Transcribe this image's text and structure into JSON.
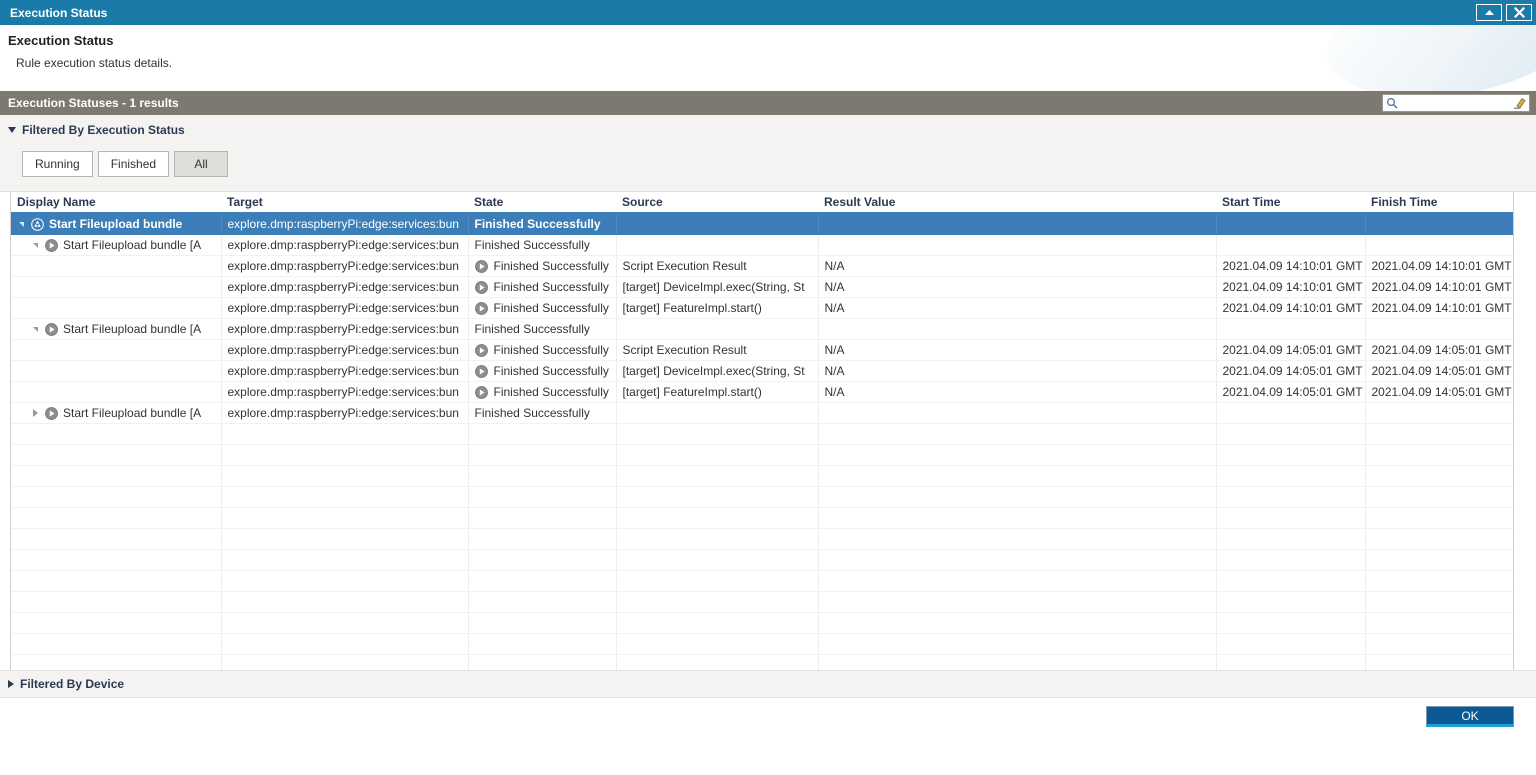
{
  "window": {
    "title": "Execution Status",
    "minimize_icon": "chevron-up-icon",
    "close_icon": "close-icon"
  },
  "header": {
    "title": "Execution Status",
    "subtitle": "Rule execution status details."
  },
  "section": {
    "title": "Execution Statuses - 1 results",
    "search": {
      "value": "",
      "placeholder": "",
      "search_icon": "search-icon",
      "clear_icon": "eraser-icon"
    }
  },
  "filter_execution_status": {
    "label": "Filtered By Execution Status",
    "expanded": true,
    "buttons": [
      {
        "label": "Running",
        "selected": false
      },
      {
        "label": "Finished",
        "selected": false
      },
      {
        "label": "All",
        "selected": true
      }
    ]
  },
  "filter_device": {
    "label": "Filtered By Device",
    "expanded": false
  },
  "table": {
    "columns": [
      {
        "key": "display_name",
        "label": "Display Name"
      },
      {
        "key": "target",
        "label": "Target"
      },
      {
        "key": "state",
        "label": "State"
      },
      {
        "key": "source",
        "label": "Source"
      },
      {
        "key": "result_value",
        "label": "Result Value"
      },
      {
        "key": "start_time",
        "label": "Start Time"
      },
      {
        "key": "finish_time",
        "label": "Finish Time"
      }
    ],
    "rows": [
      {
        "level": 0,
        "expander": "down",
        "icon": "recycle-icon",
        "selected": true,
        "display_name": "Start Fileupload bundle",
        "target": "explore.dmp:raspberryPi:edge:services:bun",
        "state": "Finished Successfully",
        "state_icon": "",
        "source": "",
        "result_value": "",
        "start_time": "",
        "finish_time": ""
      },
      {
        "level": 1,
        "expander": "down",
        "icon": "play-icon",
        "selected": false,
        "display_name": "Start Fileupload bundle [A",
        "target": "explore.dmp:raspberryPi:edge:services:bun",
        "state": "Finished Successfully",
        "state_icon": "",
        "source": "",
        "result_value": "",
        "start_time": "",
        "finish_time": ""
      },
      {
        "level": 2,
        "expander": "",
        "icon": "",
        "selected": false,
        "display_name": "",
        "target": "explore.dmp:raspberryPi:edge:services:bun",
        "state": "Finished Successfully",
        "state_icon": "play-icon",
        "source": "Script Execution Result",
        "result_value": "N/A",
        "start_time": "2021.04.09 14:10:01 GMT",
        "finish_time": "2021.04.09 14:10:01 GMT"
      },
      {
        "level": 2,
        "expander": "",
        "icon": "",
        "selected": false,
        "display_name": "",
        "target": "explore.dmp:raspberryPi:edge:services:bun",
        "state": "Finished Successfully",
        "state_icon": "play-icon",
        "source": "[target] DeviceImpl.exec(String, St",
        "result_value": "N/A",
        "start_time": "2021.04.09 14:10:01 GMT",
        "finish_time": "2021.04.09 14:10:01 GMT"
      },
      {
        "level": 2,
        "expander": "",
        "icon": "",
        "selected": false,
        "display_name": "",
        "target": "explore.dmp:raspberryPi:edge:services:bun",
        "state": "Finished Successfully",
        "state_icon": "play-icon",
        "source": "[target] FeatureImpl.start()",
        "result_value": "N/A",
        "start_time": "2021.04.09 14:10:01 GMT",
        "finish_time": "2021.04.09 14:10:01 GMT"
      },
      {
        "level": 1,
        "expander": "down",
        "icon": "play-icon",
        "selected": false,
        "display_name": "Start Fileupload bundle [A",
        "target": "explore.dmp:raspberryPi:edge:services:bun",
        "state": "Finished Successfully",
        "state_icon": "",
        "source": "",
        "result_value": "",
        "start_time": "",
        "finish_time": ""
      },
      {
        "level": 2,
        "expander": "",
        "icon": "",
        "selected": false,
        "display_name": "",
        "target": "explore.dmp:raspberryPi:edge:services:bun",
        "state": "Finished Successfully",
        "state_icon": "play-icon",
        "source": "Script Execution Result",
        "result_value": "N/A",
        "start_time": "2021.04.09 14:05:01 GMT",
        "finish_time": "2021.04.09 14:05:01 GMT"
      },
      {
        "level": 2,
        "expander": "",
        "icon": "",
        "selected": false,
        "display_name": "",
        "target": "explore.dmp:raspberryPi:edge:services:bun",
        "state": "Finished Successfully",
        "state_icon": "play-icon",
        "source": "[target] DeviceImpl.exec(String, St",
        "result_value": "N/A",
        "start_time": "2021.04.09 14:05:01 GMT",
        "finish_time": "2021.04.09 14:05:01 GMT"
      },
      {
        "level": 2,
        "expander": "",
        "icon": "",
        "selected": false,
        "display_name": "",
        "target": "explore.dmp:raspberryPi:edge:services:bun",
        "state": "Finished Successfully",
        "state_icon": "play-icon",
        "source": "[target] FeatureImpl.start()",
        "result_value": "N/A",
        "start_time": "2021.04.09 14:05:01 GMT",
        "finish_time": "2021.04.09 14:05:01 GMT"
      },
      {
        "level": 1,
        "expander": "right",
        "icon": "play-icon",
        "selected": false,
        "display_name": "Start Fileupload bundle [A",
        "target": "explore.dmp:raspberryPi:edge:services:bun",
        "state": "Finished Successfully",
        "state_icon": "",
        "source": "",
        "result_value": "",
        "start_time": "",
        "finish_time": ""
      }
    ],
    "empty_row_count": 13
  },
  "footer": {
    "ok_label": "OK"
  },
  "colors": {
    "titlebar": "#1b7ba8",
    "section_bar": "#7d7870",
    "selected_row": "#3c7fb8",
    "header_underline": "#3c7fb8",
    "ok_button": "#0b5a96",
    "panel_bg": "#f4f3f1"
  }
}
